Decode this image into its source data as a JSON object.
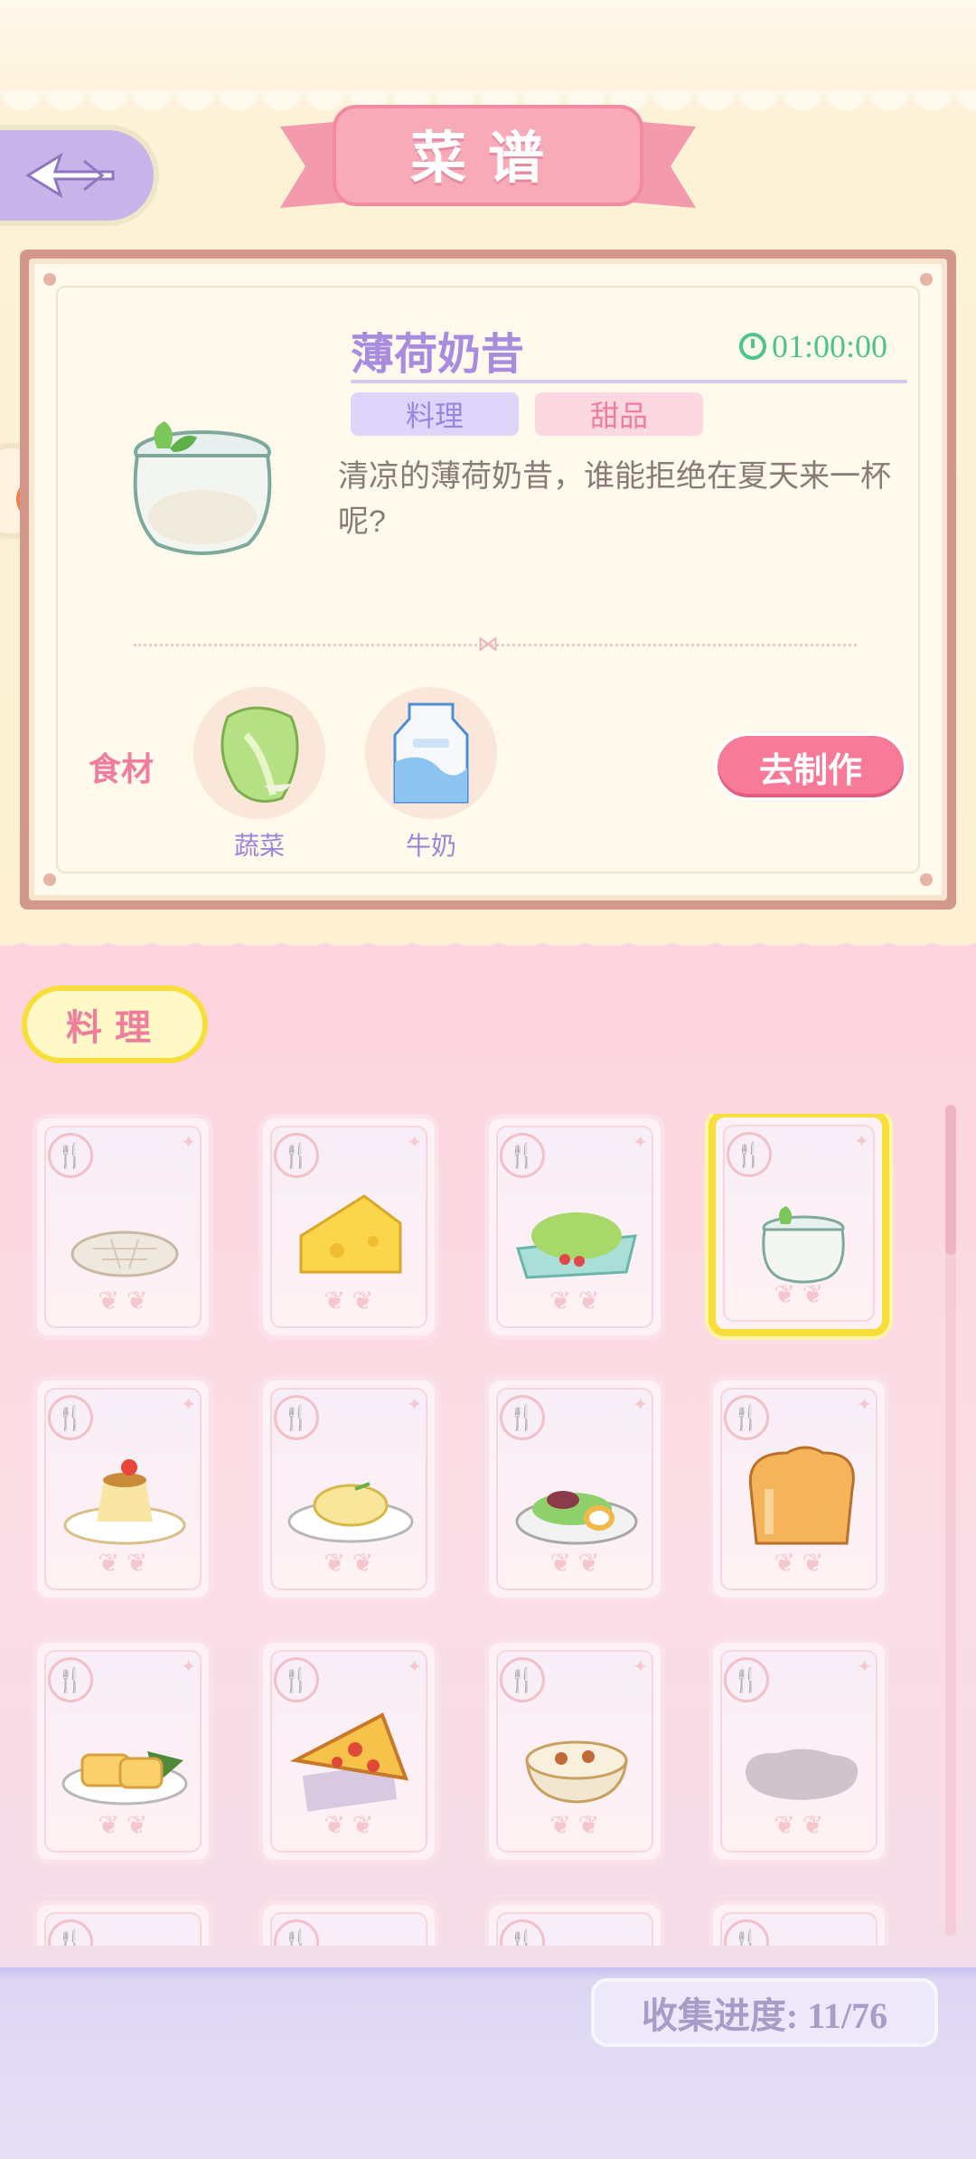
{
  "page_title": "菜谱",
  "recipe": {
    "name": "薄荷奶昔",
    "timer": "01:00:00",
    "tags": [
      "料理",
      "甜品"
    ],
    "description": "清凉的薄荷奶昔，谁能拒绝在夏天来一杯呢?",
    "ingredients_label": "食材",
    "ingredients": [
      {
        "name": "蔬菜",
        "icon": "cabbage-icon"
      },
      {
        "name": "牛奶",
        "icon": "milk-carton-icon"
      }
    ],
    "make_button": "去制作"
  },
  "category_tab": "料理",
  "grid_items": [
    {
      "food": "flatbread",
      "collected": true
    },
    {
      "food": "cheese",
      "collected": true
    },
    {
      "food": "salad",
      "collected": true
    },
    {
      "food": "mint-milkshake",
      "collected": true,
      "selected": true
    },
    {
      "food": "pudding",
      "collected": true
    },
    {
      "food": "cheesecake",
      "collected": true
    },
    {
      "food": "meat-salad",
      "collected": true
    },
    {
      "food": "bread-loaf",
      "collected": true
    },
    {
      "food": "egg-roll",
      "collected": true
    },
    {
      "food": "pizza-slice",
      "collected": true
    },
    {
      "food": "soup-bowl",
      "collected": true
    },
    {
      "food": "unknown",
      "collected": false
    }
  ],
  "progress_text": "收集进度: 11/76",
  "colors": {
    "accent_pink": "#f77a98",
    "accent_purple": "#a98be0",
    "highlight_yellow": "#f8de3a",
    "timer_green": "#4cc490"
  }
}
